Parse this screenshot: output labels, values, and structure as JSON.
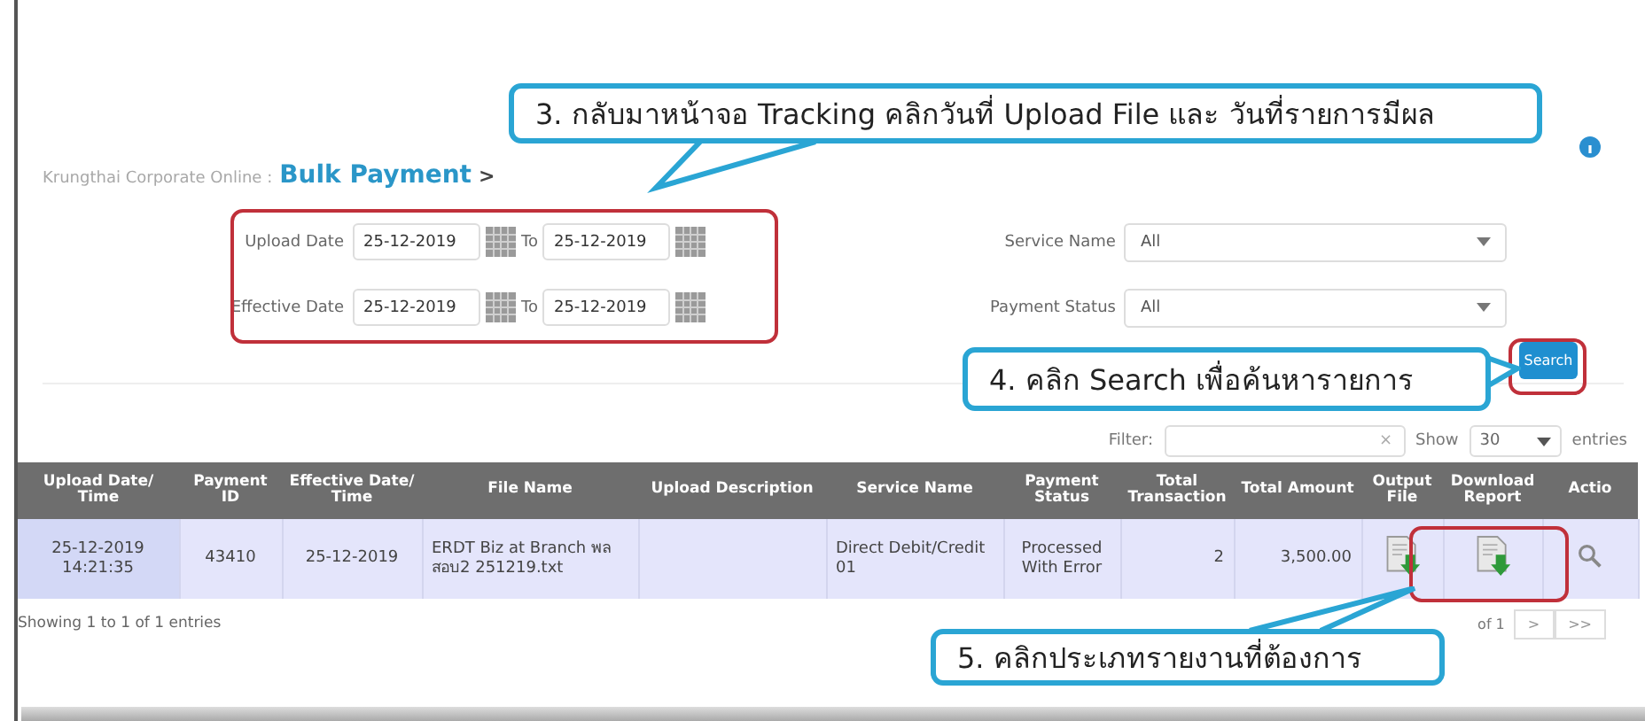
{
  "breadcrumb": {
    "site": "Krungthai Corporate Online :",
    "page": "Bulk Payment",
    "separator": ">"
  },
  "search_form": {
    "upload_date": {
      "label": "Upload Date",
      "from": "25-12-2019",
      "to_label": "To",
      "to": "25-12-2019"
    },
    "effective_date": {
      "label": "Effective Date",
      "from": "25-12-2019",
      "to_label": "To",
      "to": "25-12-2019"
    },
    "service_name": {
      "label": "Service Name",
      "value": "All"
    },
    "payment_status": {
      "label": "Payment Status",
      "value": "All"
    },
    "search_button": "Search"
  },
  "table_controls": {
    "filter_label": "Filter:",
    "clear": "×",
    "show_label": "Show",
    "page_size": "30",
    "entries_label": "entries"
  },
  "table": {
    "columns": [
      "Upload Date/ Time",
      "Payment ID",
      "Effective Date/ Time",
      "File Name",
      "Upload Description",
      "Service Name",
      "Payment Status",
      "Total Transaction",
      "Total Amount",
      "Output File",
      "Download Report",
      "Actio"
    ],
    "rows": [
      {
        "upload_datetime": "25-12-2019 14:21:35",
        "payment_id": "43410",
        "effective_date": "25-12-2019",
        "file_name": "ERDT Biz at Branch พลสอบ2 251219.txt",
        "upload_description": "",
        "service_name": "Direct Debit/Credit 01",
        "payment_status": "Processed With Error",
        "total_transaction": "2",
        "total_amount": "3,500.00"
      }
    ]
  },
  "footer": {
    "summary": "Showing 1 to 1 of 1 entries",
    "pager": [
      "of 1",
      ">",
      ">>"
    ]
  },
  "callouts": [
    {
      "text": "3. กลับมาหน้าจอ Tracking คลิกวันที่ Upload File และ วันที่รายการมีผล"
    },
    {
      "text": "4. คลิก Search เพื่อค้นหารายการ"
    },
    {
      "text": "5. คลิกประเภทรายงานที่ต้องการ"
    }
  ]
}
